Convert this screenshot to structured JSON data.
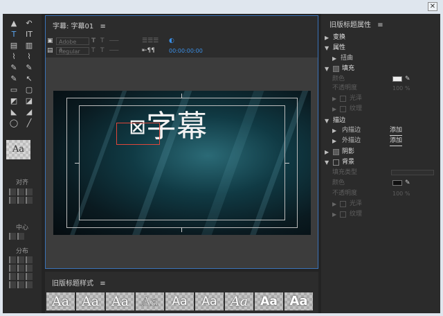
{
  "window": {
    "close_glyph": "✕"
  },
  "tools": {
    "items": [
      "▲",
      "↶",
      "T",
      "IT",
      "▤",
      "▥",
      "⌇",
      "⌇",
      "✎",
      "✎",
      "✎",
      "↖",
      "▭",
      "▢",
      "◩",
      "◪",
      "◣",
      "◢",
      "◯",
      "╱"
    ],
    "sample_text": "Aa",
    "align_label": "对齐",
    "center_label": "中心",
    "distribute_label": "分布"
  },
  "editor": {
    "tab_label": "字幕: 字幕01",
    "menu_glyph": "≡",
    "font_family": "Adobe A...",
    "font_style": "Regular",
    "timecode": "00:00:00:00",
    "caption_text": "字幕",
    "caption_glyph": "⊠"
  },
  "styles": {
    "label": "旧版标题样式",
    "menu_glyph": "≡",
    "swatches": [
      "Aa",
      "Aa",
      "Aa",
      "Aa",
      "Aa",
      "Aa",
      "Aa",
      "Aa",
      "Aa"
    ]
  },
  "props": {
    "title": "旧版标题属性",
    "menu_glyph": "≡",
    "transform": "变换",
    "properties": "属性",
    "distort": "扭曲",
    "fill": "填充",
    "fill_type": "颜色",
    "opacity": "不透明度",
    "opacity_value": "100 %",
    "sheen": "光泽",
    "texture": "纹理",
    "strokes": "描边",
    "inner_strokes": "内描边",
    "outer_strokes": "外描边",
    "add": "添加",
    "shadow": "阴影",
    "background": "背景",
    "bg_fill_type": "填充类型",
    "bg_color": "颜色",
    "bg_opacity": "不透明度",
    "bg_opacity_value": "100 %",
    "bg_sheen": "光泽",
    "bg_texture": "纹理"
  },
  "colors": {
    "accent": "#3b73b9",
    "timecode": "#3b8fe6",
    "selection": "#e0473a"
  }
}
